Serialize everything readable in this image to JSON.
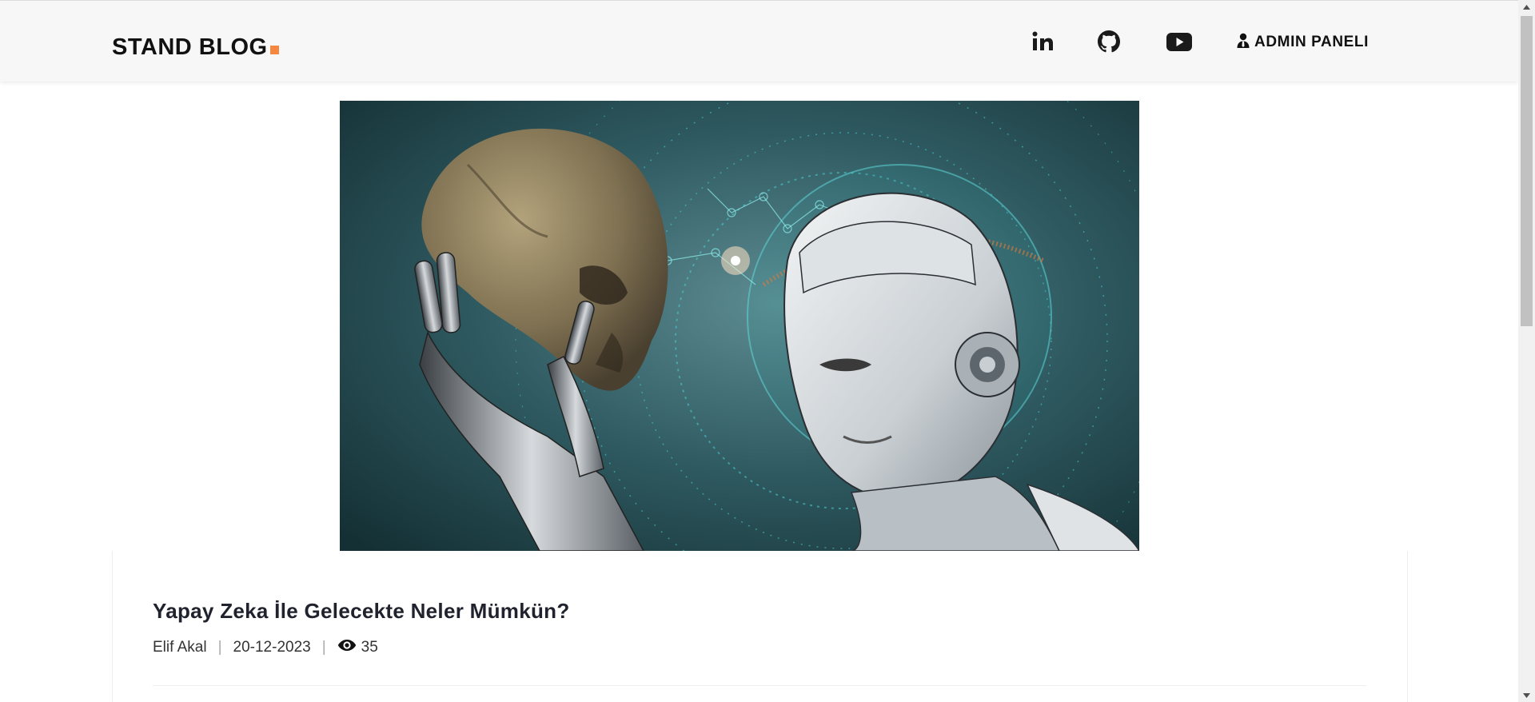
{
  "header": {
    "brand": "STAND BLOG",
    "brand_accent_color": "#f48840",
    "social_icons": [
      "linkedin-icon",
      "github-icon",
      "youtube-icon"
    ],
    "admin_label": "ADMIN PANELI",
    "admin_icon": "user-tie-icon"
  },
  "hero": {
    "image": "ai-robot-holding-skull-illustration"
  },
  "post": {
    "title": "Yapay Zeka İle Gelecekte Neler Mümkün?",
    "author": "Elif Akal",
    "date": "20-12-2023",
    "views": "35",
    "views_icon": "eye-icon",
    "separator": "|"
  },
  "colors": {
    "header_bg": "#f7f7f7",
    "text_dark": "#20232e",
    "accent": "#f48840"
  }
}
